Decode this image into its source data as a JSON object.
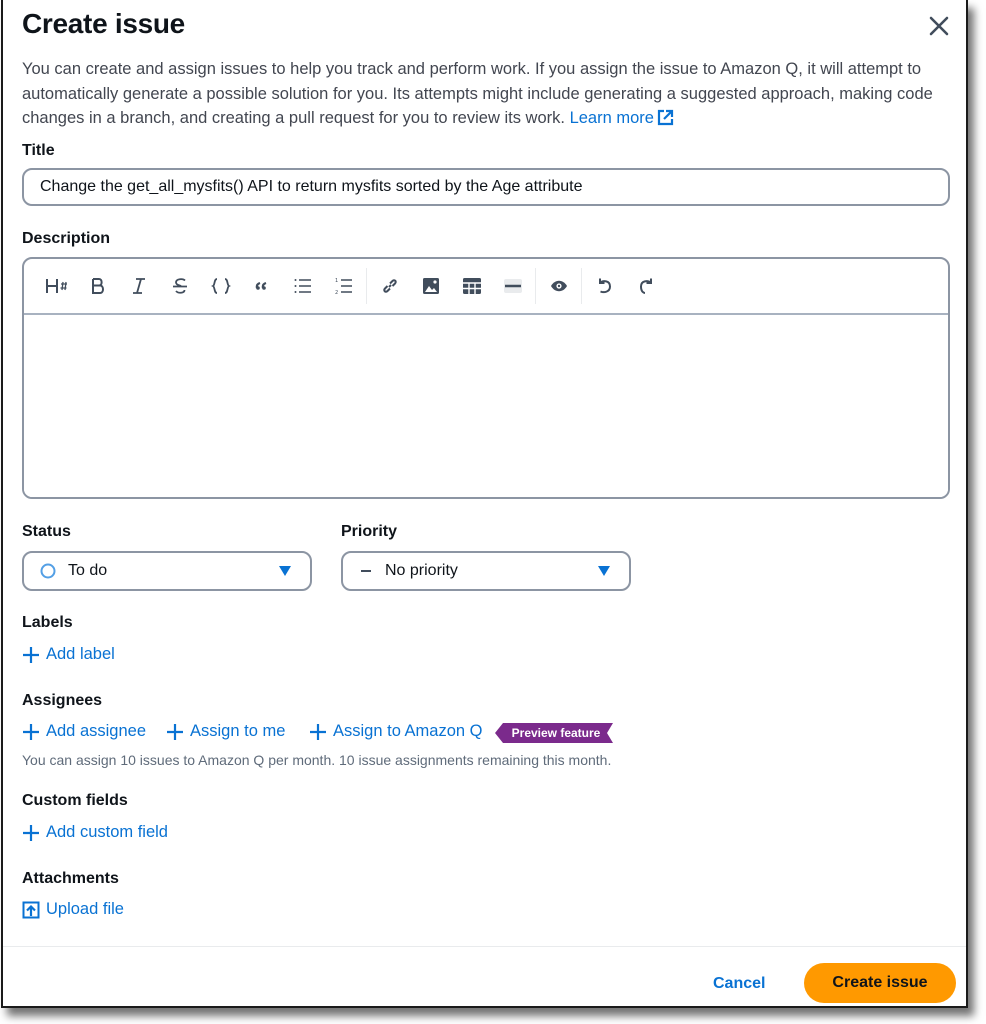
{
  "dialog": {
    "title": "Create issue",
    "close_icon": "close-icon",
    "intro_text": "You can create and assign issues to help you track and perform work. If you assign the issue to Amazon Q, it will attempt to automatically generate a possible solution for you. Its attempts might include generating a suggested approach, making code changes in a branch, and creating a pull request for you to review its work.",
    "learn_more_label": "Learn more",
    "learn_more_icon": "external-link-icon"
  },
  "title_field": {
    "label": "Title",
    "value": "Change the get_all_mysfits() API to return mysfits sorted by the Age attribute",
    "placeholder": ""
  },
  "description_field": {
    "label": "Description",
    "value": "",
    "toolbar": [
      {
        "name": "heading",
        "icon": "heading-icon"
      },
      {
        "name": "bold",
        "icon": "bold-icon"
      },
      {
        "name": "italic",
        "icon": "italic-icon"
      },
      {
        "name": "strikethrough",
        "icon": "strikethrough-icon"
      },
      {
        "name": "code",
        "icon": "code-icon"
      },
      {
        "name": "quote",
        "icon": "quote-icon"
      },
      {
        "name": "bulleted-list",
        "icon": "bulleted-list-icon"
      },
      {
        "name": "numbered-list",
        "icon": "numbered-list-icon"
      },
      {
        "name": "link",
        "icon": "link-icon"
      },
      {
        "name": "image",
        "icon": "image-icon"
      },
      {
        "name": "table",
        "icon": "table-icon"
      },
      {
        "name": "horizontal-rule",
        "icon": "horizontal-rule-icon",
        "disabled": true
      },
      {
        "name": "preview",
        "icon": "eye-icon"
      },
      {
        "name": "undo",
        "icon": "undo-icon"
      },
      {
        "name": "redo",
        "icon": "redo-icon"
      }
    ]
  },
  "status_field": {
    "label": "Status",
    "value": "To do",
    "icon": "circle-icon"
  },
  "priority_field": {
    "label": "Priority",
    "value": "No priority",
    "icon": "dash-icon"
  },
  "labels": {
    "label": "Labels",
    "add_label": "Add label"
  },
  "assignees": {
    "label": "Assignees",
    "add_assignee": "Add assignee",
    "assign_to_me": "Assign to me",
    "assign_to_q": "Assign to Amazon Q",
    "badge": "Preview feature",
    "help_text": "You can assign 10 issues to Amazon Q per month. 10 issue assignments remaining this month."
  },
  "custom_fields": {
    "label": "Custom fields",
    "add_custom_field": "Add custom field"
  },
  "attachments": {
    "label": "Attachments",
    "upload_file": "Upload file"
  },
  "footer": {
    "cancel_label": "Cancel",
    "submit_label": "Create issue"
  },
  "colors": {
    "link": "#0972d3",
    "primary_button": "#ff9900",
    "badge": "#7d2105",
    "badge_purple": "#7b2a8c",
    "border": "#8c95a3"
  }
}
